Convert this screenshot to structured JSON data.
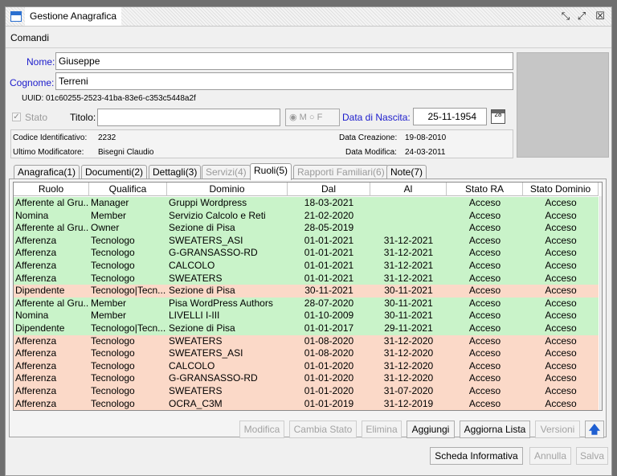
{
  "window": {
    "title": "Gestione Anagrafica"
  },
  "menu": {
    "comandi": "Comandi"
  },
  "person": {
    "nome_label": "Nome:",
    "nome_value": "Giuseppe",
    "cognome_label": "Cognome:",
    "cognome_value": "Terreni",
    "uuid": "UUID: 01c60255-2523-41ba-83e6-c353c5448a2f",
    "stato_label": "Stato",
    "titolo_label": "Titolo:",
    "sex_m": "M",
    "sex_f": "F",
    "nascita_label": "Data di Nascita:",
    "nascita_value": "25-11-1954"
  },
  "info": {
    "codice_label": "Codice Identificativo:",
    "codice_value": "2232",
    "creazione_label": "Data Creazione:",
    "creazione_value": "19-08-2010",
    "modificatore_label": "Ultimo Modificatore:",
    "modificatore_value": "Bisegni Claudio",
    "modifica_label": "Data Modifica:",
    "modifica_value": "24-03-2011"
  },
  "tabs": [
    {
      "label": "Anagrafica(1)",
      "state": "normal"
    },
    {
      "label": "Documenti(2)",
      "state": "normal"
    },
    {
      "label": "Dettagli(3)",
      "state": "normal"
    },
    {
      "label": "Servizi(4)",
      "state": "disabled"
    },
    {
      "label": "Ruoli(5)",
      "state": "active"
    },
    {
      "label": "Rapporti Familiari(6)",
      "state": "disabled"
    },
    {
      "label": "Note(7)",
      "state": "normal"
    }
  ],
  "table": {
    "columns": [
      "Ruolo",
      "Qualifica",
      "Dominio",
      "Dal",
      "Al",
      "Stato RA",
      "Stato Dominio"
    ],
    "colors": {
      "green": "#c9f3c9",
      "red": "#fbd9c8"
    },
    "rows": [
      {
        "c": [
          "Afferente al Gru...",
          "Manager",
          "Gruppi Wordpress",
          "18-03-2021",
          "",
          "Acceso",
          "Acceso"
        ],
        "color": "green"
      },
      {
        "c": [
          "Nomina",
          "Member",
          "Servizio Calcolo e Reti",
          "21-02-2020",
          "",
          "Acceso",
          "Acceso"
        ],
        "color": "green"
      },
      {
        "c": [
          "Afferente al Gru...",
          "Owner",
          "Sezione di Pisa",
          "28-05-2019",
          "",
          "Acceso",
          "Acceso"
        ],
        "color": "green"
      },
      {
        "c": [
          "Afferenza",
          "Tecnologo",
          "SWEATERS_ASI",
          "01-01-2021",
          "31-12-2021",
          "Acceso",
          "Acceso"
        ],
        "color": "green"
      },
      {
        "c": [
          "Afferenza",
          "Tecnologo",
          "G-GRANSASSO-RD",
          "01-01-2021",
          "31-12-2021",
          "Acceso",
          "Acceso"
        ],
        "color": "green"
      },
      {
        "c": [
          "Afferenza",
          "Tecnologo",
          "CALCOLO",
          "01-01-2021",
          "31-12-2021",
          "Acceso",
          "Acceso"
        ],
        "color": "green"
      },
      {
        "c": [
          "Afferenza",
          "Tecnologo",
          "SWEATERS",
          "01-01-2021",
          "31-12-2021",
          "Acceso",
          "Acceso"
        ],
        "color": "green"
      },
      {
        "c": [
          "Dipendente",
          "Tecnologo|Tecn...",
          "Sezione di Pisa",
          "30-11-2021",
          "30-11-2021",
          "Acceso",
          "Acceso"
        ],
        "color": "red"
      },
      {
        "c": [
          "Afferente al Gru...",
          "Member",
          "Pisa WordPress Authors",
          "28-07-2020",
          "30-11-2021",
          "Acceso",
          "Acceso"
        ],
        "color": "green"
      },
      {
        "c": [
          "Nomina",
          "Member",
          "LIVELLI I-III",
          "01-10-2009",
          "30-11-2021",
          "Acceso",
          "Acceso"
        ],
        "color": "green"
      },
      {
        "c": [
          "Dipendente",
          "Tecnologo|Tecn...",
          "Sezione di Pisa",
          "01-01-2017",
          "29-11-2021",
          "Acceso",
          "Acceso"
        ],
        "color": "green"
      },
      {
        "c": [
          "Afferenza",
          "Tecnologo",
          "SWEATERS",
          "01-08-2020",
          "31-12-2020",
          "Acceso",
          "Acceso"
        ],
        "color": "red"
      },
      {
        "c": [
          "Afferenza",
          "Tecnologo",
          "SWEATERS_ASI",
          "01-08-2020",
          "31-12-2020",
          "Acceso",
          "Acceso"
        ],
        "color": "red"
      },
      {
        "c": [
          "Afferenza",
          "Tecnologo",
          "CALCOLO",
          "01-01-2020",
          "31-12-2020",
          "Acceso",
          "Acceso"
        ],
        "color": "red"
      },
      {
        "c": [
          "Afferenza",
          "Tecnologo",
          "G-GRANSASSO-RD",
          "01-01-2020",
          "31-12-2020",
          "Acceso",
          "Acceso"
        ],
        "color": "red"
      },
      {
        "c": [
          "Afferenza",
          "Tecnologo",
          "SWEATERS",
          "01-01-2020",
          "31-07-2020",
          "Acceso",
          "Acceso"
        ],
        "color": "red"
      },
      {
        "c": [
          "Afferenza",
          "Tecnologo",
          "OCRA_C3M",
          "01-01-2019",
          "31-12-2019",
          "Acceso",
          "Acceso"
        ],
        "color": "red"
      }
    ]
  },
  "grid_buttons": {
    "modifica": "Modifica",
    "cambia_stato": "Cambia Stato",
    "elimina": "Elimina",
    "aggiungi": "Aggiungi",
    "aggiorna": "Aggiorna Lista",
    "versioni": "Versioni",
    "up_icon": "arrow-up-icon"
  },
  "footer_buttons": {
    "scheda": "Scheda Informativa",
    "annulla": "Annulla",
    "salva": "Salva"
  },
  "icons": {
    "window": "window-icon",
    "minimize": "shrink-icon",
    "maximize": "expand-icon",
    "close": "close-icon",
    "calendar": "calendar-icon"
  }
}
